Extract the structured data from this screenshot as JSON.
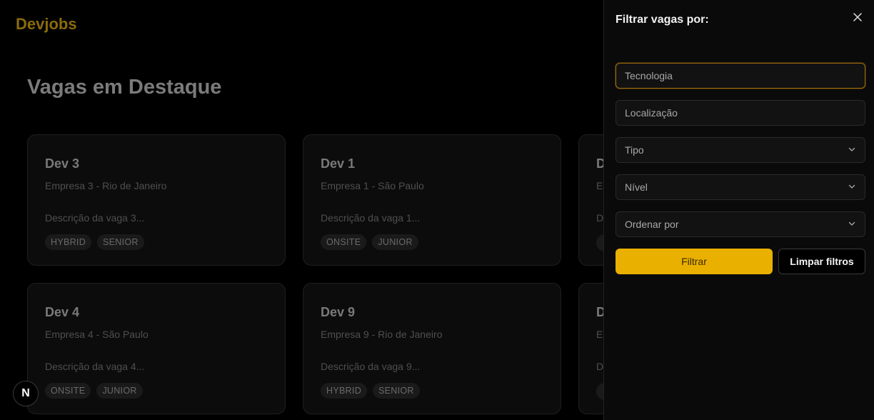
{
  "header": {
    "logo": "Devjobs"
  },
  "main": {
    "title": "Vagas em Destaque",
    "cards": [
      {
        "title": "Dev 3",
        "company": "Empresa 3 - Rio de Janeiro",
        "description": "Descrição da vaga 3...",
        "tags": [
          "HYBRID",
          "SENIOR"
        ]
      },
      {
        "title": "Dev 1",
        "company": "Empresa 1 - São Paulo",
        "description": "Descrição da vaga 1...",
        "tags": [
          "ONSITE",
          "JUNIOR"
        ]
      },
      {
        "title": "D",
        "company": "E",
        "description": "D",
        "tags": [
          ""
        ]
      },
      {
        "title": "Dev 4",
        "company": "Empresa 4 - São Paulo",
        "description": "Descrição da vaga 4...",
        "tags": [
          "ONSITE",
          "JUNIOR"
        ]
      },
      {
        "title": "Dev 9",
        "company": "Empresa 9 - Rio de Janeiro",
        "description": "Descrição da vaga 9...",
        "tags": [
          "HYBRID",
          "SENIOR"
        ]
      },
      {
        "title": "D",
        "company": "E",
        "description": "D",
        "tags": [
          ""
        ]
      }
    ]
  },
  "dev_badge": {
    "label": "N"
  },
  "filter_panel": {
    "title": "Filtrar vagas por:",
    "close_icon": "close-icon",
    "technology_placeholder": "Tecnologia",
    "location_placeholder": "Localização",
    "type_label": "Tipo",
    "level_label": "Nível",
    "sort_label": "Ordenar por",
    "filter_button": "Filtrar",
    "clear_button": "Limpar filtros"
  },
  "colors": {
    "accent": "#eab000",
    "logo": "#8a6a0a",
    "background": "#000000",
    "panel": "#0a0a0b"
  }
}
